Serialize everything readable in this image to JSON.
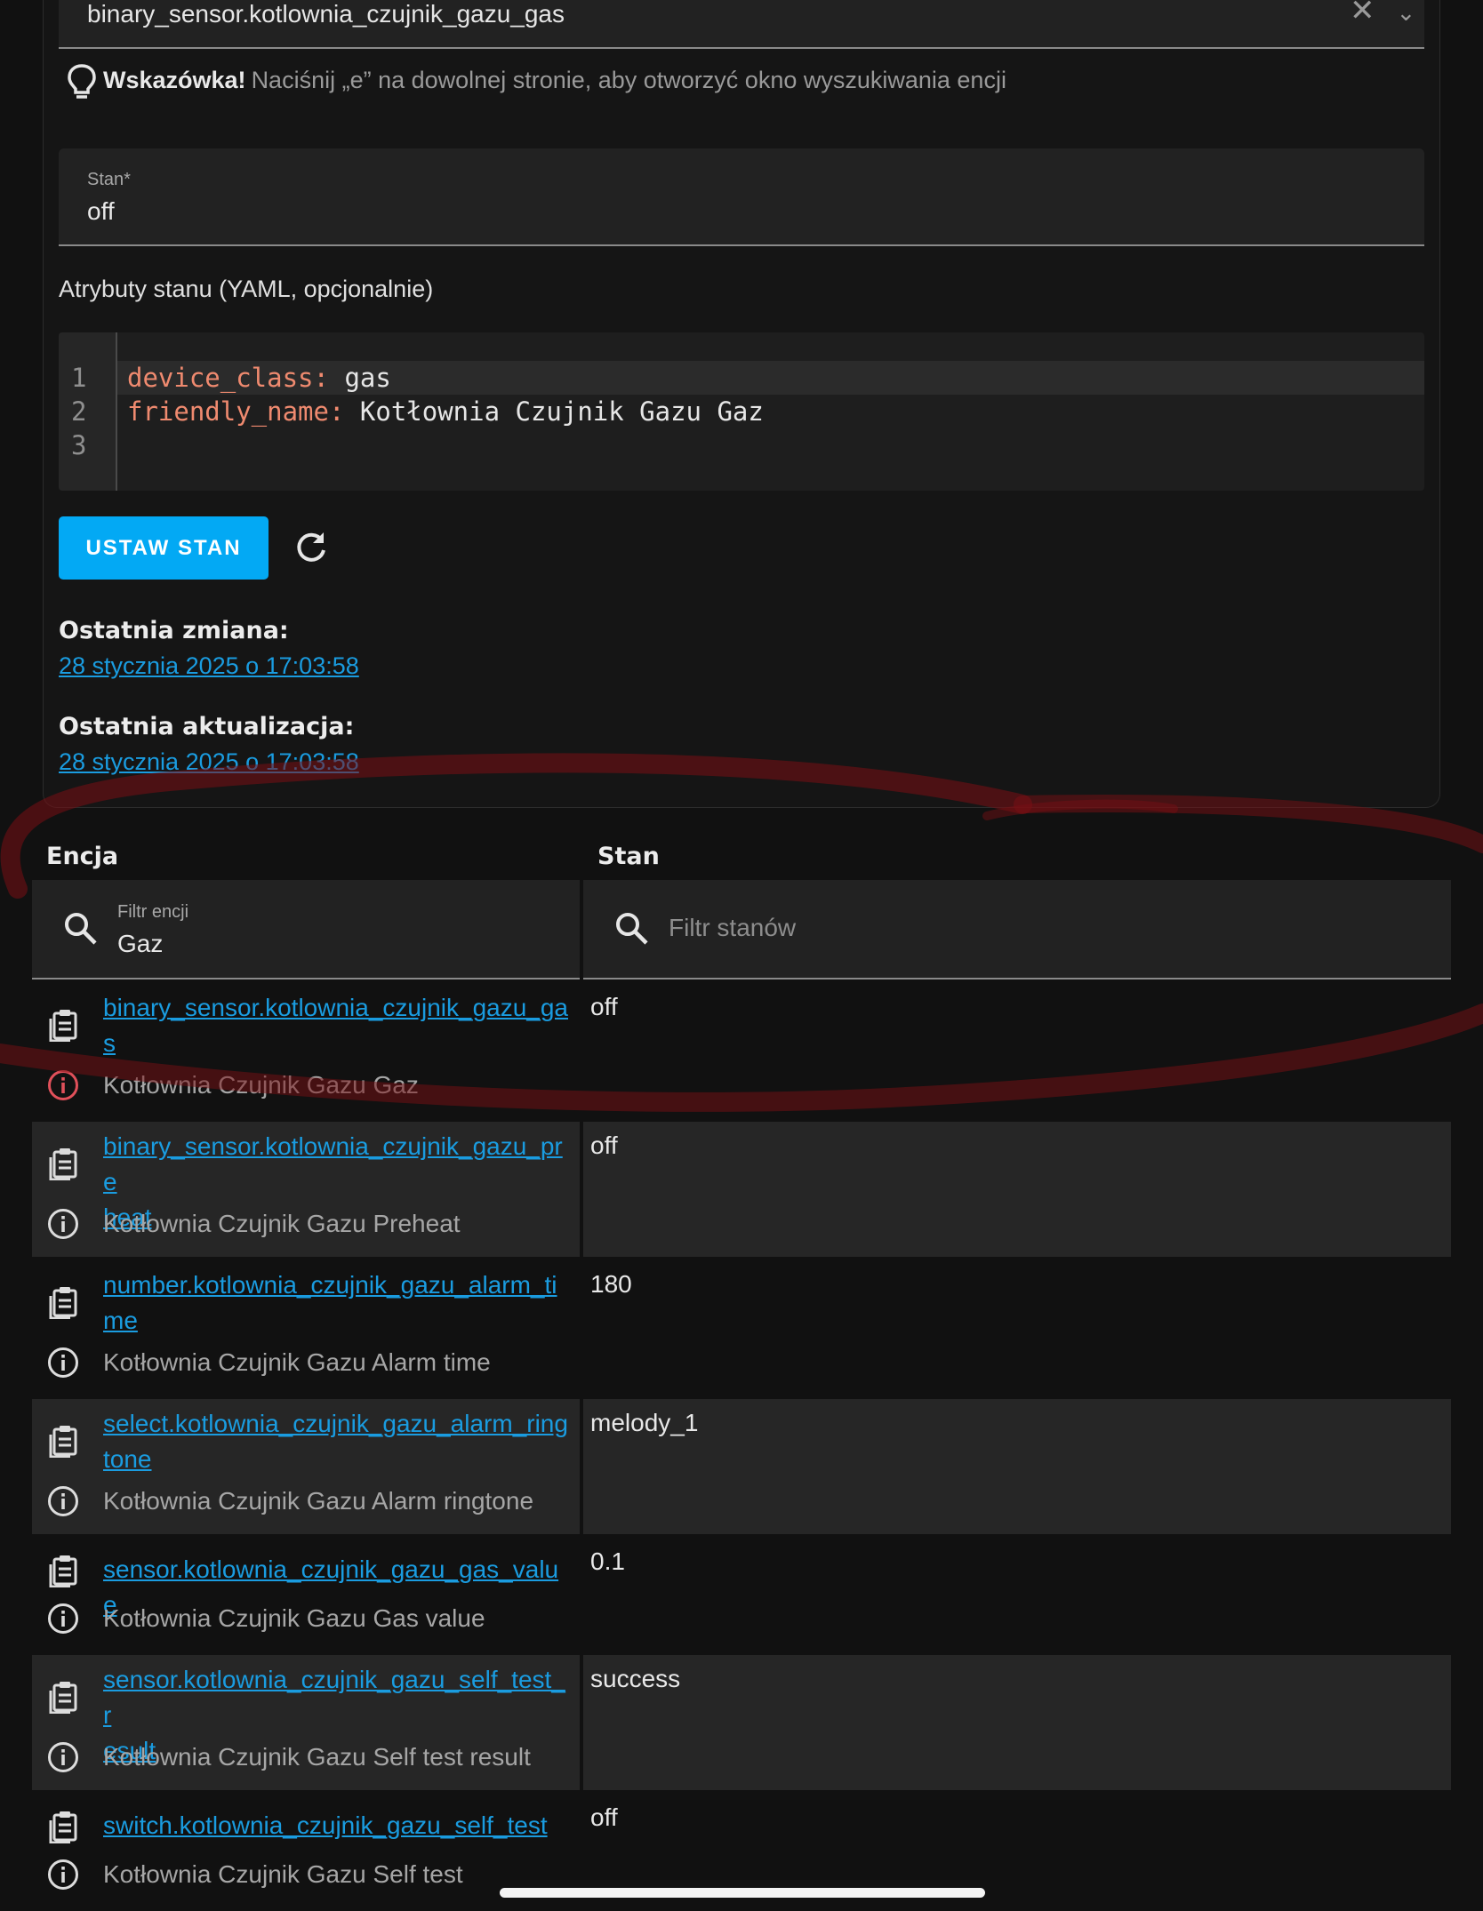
{
  "entity_picker": {
    "value": "binary_sensor.kotlownia_czujnik_gazu_gas"
  },
  "hint": {
    "bold": "Wskazówka!",
    "text": "Naciśnij „e” na dowolnej stronie, aby otworzyć okno wyszukiwania encji"
  },
  "state_field": {
    "label": "Stan*",
    "value": "off"
  },
  "attributes": {
    "title": "Atrybuty stanu (YAML, opcjonalnie)",
    "line_numbers": [
      "1",
      "2",
      "3"
    ],
    "lines": [
      {
        "key": "device_class",
        "value": "gas"
      },
      {
        "key": "friendly_name",
        "value": "Kotłownia Czujnik Gazu Gaz"
      }
    ]
  },
  "set_state_button": "USTAW STAN",
  "last_changed": {
    "label": "Ostatnia zmiana:",
    "value": "28 stycznia 2025 o 17:03:58"
  },
  "last_updated": {
    "label": "Ostatnia aktualizacja:",
    "value": "28 stycznia 2025 o 17:03:58"
  },
  "table": {
    "col_entity": "Encja",
    "col_state": "Stan",
    "entity_filter": {
      "label": "Filtr encji",
      "value": "Gaz"
    },
    "state_filter": {
      "placeholder": "Filtr stanów"
    },
    "rows": [
      {
        "entity_id_l1": "binary_sensor.kotlownia_czujnik_gazu_ga",
        "entity_id_l2": "s",
        "friendly": "Kotłownia Czujnik Gazu Gaz",
        "state": "off"
      },
      {
        "entity_id_l1": "binary_sensor.kotlownia_czujnik_gazu_pre",
        "entity_id_l2": "heat",
        "friendly": "Kotłownia Czujnik Gazu Preheat",
        "state": "off"
      },
      {
        "entity_id_l1": "number.kotlownia_czujnik_gazu_alarm_ti",
        "entity_id_l2": "me",
        "friendly": "Kotłownia Czujnik Gazu Alarm time",
        "state": "180"
      },
      {
        "entity_id_l1": "select.kotlownia_czujnik_gazu_alarm_ring",
        "entity_id_l2": "tone",
        "friendly": "Kotłownia Czujnik Gazu Alarm ringtone",
        "state": "melody_1"
      },
      {
        "entity_id_l1": "sensor.kotlownia_czujnik_gazu_gas_value",
        "entity_id_l2": "",
        "friendly": "Kotłownia Czujnik Gazu Gas value",
        "state": "0.1"
      },
      {
        "entity_id_l1": "sensor.kotlownia_czujnik_gazu_self_test_r",
        "entity_id_l2": "esult",
        "friendly": "Kotłownia Czujnik Gazu Self test result",
        "state": "success"
      },
      {
        "entity_id_l1": "switch.kotlownia_czujnik_gazu_self_test",
        "entity_id_l2": "",
        "friendly": "Kotłownia Czujnik Gazu Self test",
        "state": "off"
      }
    ]
  },
  "colors": {
    "accent": "#03a9f4",
    "link": "#1a9ce0",
    "annotation": "#7a0f14",
    "error_icon": "#e0505a"
  }
}
